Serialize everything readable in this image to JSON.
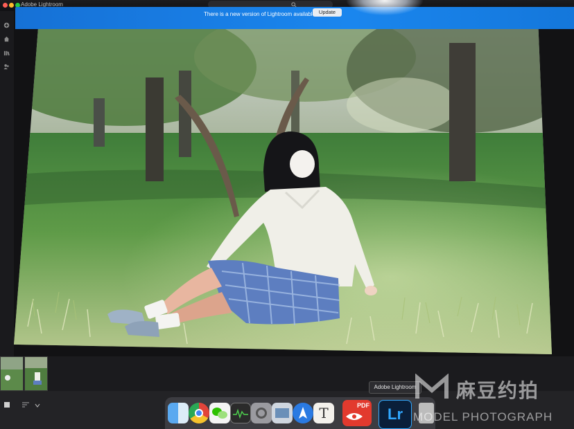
{
  "window": {
    "app_title": "Adobe Lightroom"
  },
  "banner": {
    "message": "There is a new version of Lightroom available.",
    "update_label": "Update"
  },
  "rail": {
    "icons": [
      "add-photo-icon",
      "home-icon",
      "library-icon",
      "people-icon"
    ]
  },
  "photo": {
    "description_icon": "photo-image"
  },
  "filmstrip": {
    "thumbnails": [
      "thumbnail-1",
      "thumbnail-2"
    ]
  },
  "bottombar": {
    "icons": [
      "square-grid-icon",
      "sort-icon",
      "chevron-down-icon"
    ]
  },
  "dock": {
    "tooltip": "Adobe Lightroom",
    "apps": [
      "finder",
      "chrome",
      "wechat",
      "activity-monitor",
      "system-preferences",
      "preview",
      "safari-navigation",
      "typora",
      "pdf-expert",
      "adobe-lightroom",
      "trash"
    ],
    "lightroom_label": "Lr",
    "pdf_label": "PDF",
    "typora_label": "T"
  },
  "watermark": {
    "cn": "麻豆约拍",
    "en": "MODEL PHOTOGRAPH"
  },
  "colors": {
    "banner_blue": "#1a86ee",
    "lightroom_blue": "#0a1f3a",
    "lightroom_text": "#31a8ff"
  }
}
